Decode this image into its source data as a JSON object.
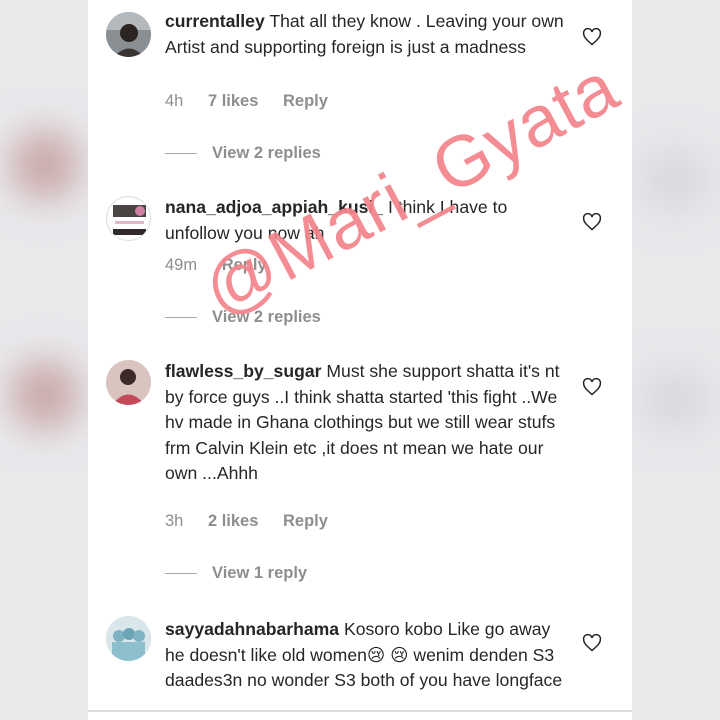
{
  "comments": [
    {
      "username": "currentalley",
      "text": "That all they know . Leaving your own Artist and supporting foreign is just a madness",
      "time": "4h",
      "likes": "7 likes",
      "reply_label": "Reply",
      "view_replies": "View 2 replies",
      "avatar_color": "#6a6a6a"
    },
    {
      "username": "nana_adjoa_appiah_kusi_",
      "text": "I think I have to unfollow you now ah",
      "time": "49m",
      "likes": "",
      "reply_label": "Reply",
      "view_replies": "View 2 replies",
      "avatar_color": "#f0f0f0"
    },
    {
      "username": "flawless_by_sugar",
      "text": "Must she support shatta it's nt by force guys ..I think shatta started 'this fight ..We hv made in Ghana clothings but we still wear stufs frm Calvin Klein etc ,it does nt mean we hate our own ...Ahhh",
      "time": "3h",
      "likes": "2 likes",
      "reply_label": "Reply",
      "view_replies": "View 1 reply",
      "avatar_color": "#c9a8a2"
    },
    {
      "username": "sayyadahnabarhama",
      "text": "Kosoro kobo Like go away he doesn't like old women😢 😢 wenim denden S3 daades3n no wonder S3 both of you have longface",
      "avatar_color": "#b8d3dc"
    }
  ],
  "watermark": "@Mari_Gyata",
  "colors": {
    "text": "#262626",
    "meta": "#8e8e8e",
    "watermark": "#f3848a"
  }
}
